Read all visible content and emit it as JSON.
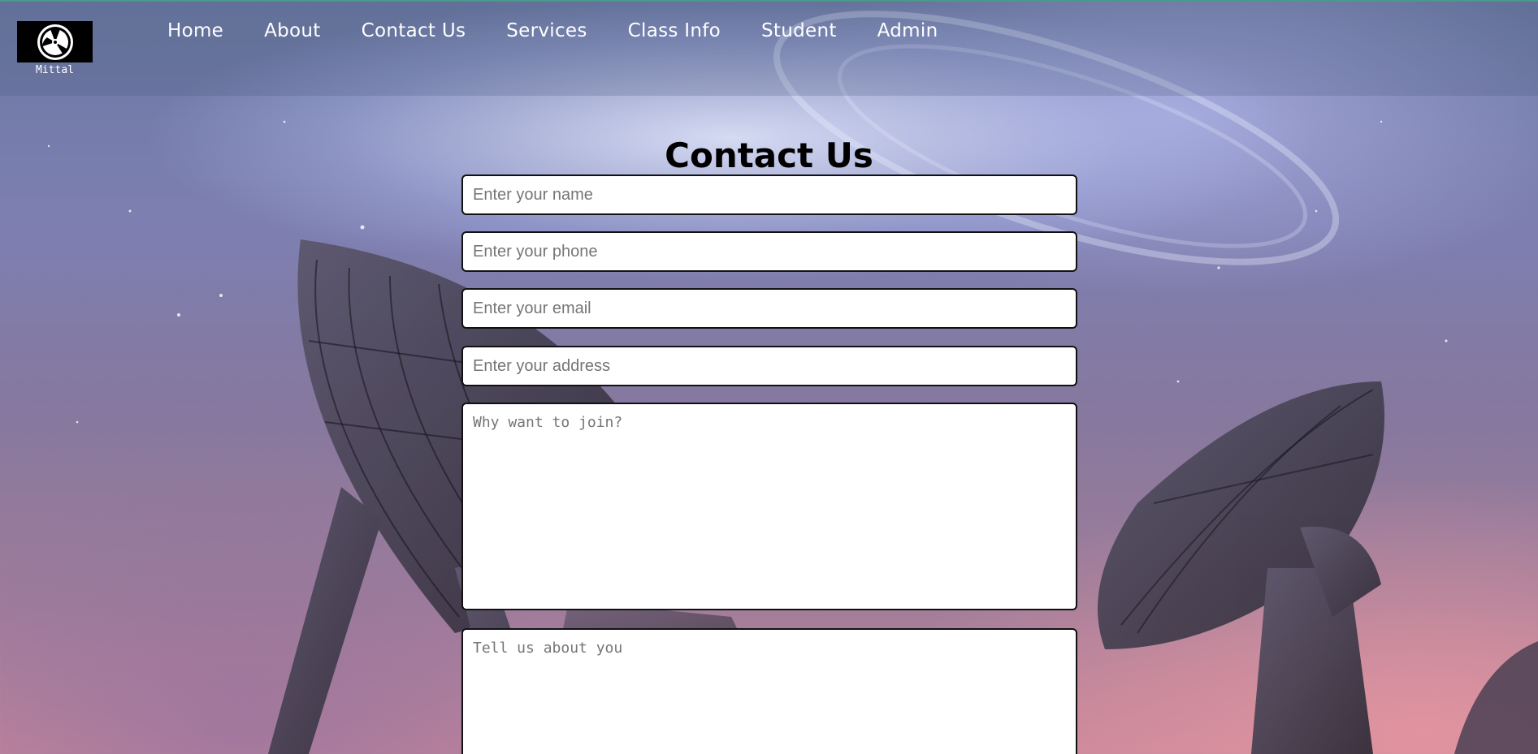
{
  "brand": {
    "logo_text": "Mittal"
  },
  "nav": {
    "items": [
      {
        "label": "Home"
      },
      {
        "label": "About"
      },
      {
        "label": "Contact Us"
      },
      {
        "label": "Services"
      },
      {
        "label": "Class Info"
      },
      {
        "label": "Student"
      },
      {
        "label": "Admin"
      }
    ]
  },
  "form": {
    "title": "Contact Us",
    "name_placeholder": "Enter your name",
    "phone_placeholder": "Enter your phone",
    "email_placeholder": "Enter your email",
    "address_placeholder": "Enter your address",
    "why_placeholder": "Why want to join?",
    "about_placeholder": "Tell us about you"
  },
  "colors": {
    "nav_text": "#ffffff",
    "field_border": "#111111",
    "title_text": "#000000"
  }
}
